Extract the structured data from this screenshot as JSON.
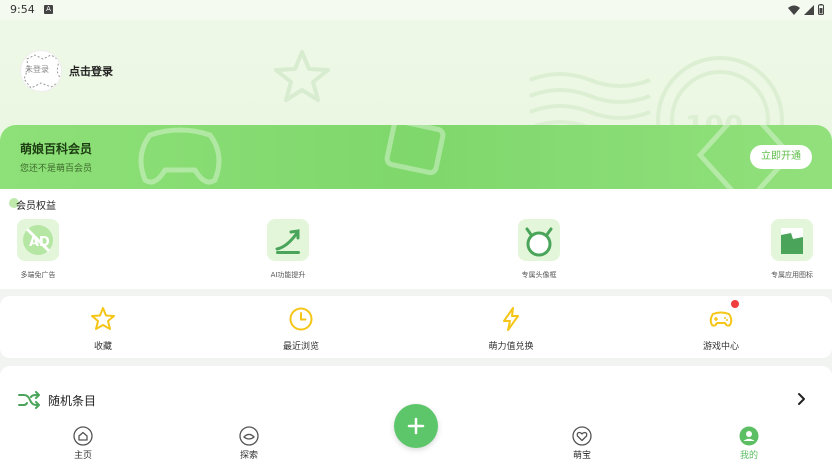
{
  "status": {
    "time": "9:54",
    "notification_icon": "A"
  },
  "profile": {
    "avatar_text": "未登录",
    "login_label": "点击登录"
  },
  "vip": {
    "title": "萌娘百科会员",
    "subtitle": "您还不是萌百会员",
    "button": "立即开通"
  },
  "benefits": {
    "title": "会员权益",
    "items": [
      {
        "label": "多端免广告",
        "icon": "no-ad-icon"
      },
      {
        "label": "AI功能提升",
        "icon": "trend-up-icon"
      },
      {
        "label": "专属头像框",
        "icon": "cat-avatar-frame-icon"
      },
      {
        "label": "专属应用图标",
        "icon": "app-icon"
      }
    ]
  },
  "quick": [
    {
      "label": "收藏",
      "icon": "star-icon"
    },
    {
      "label": "最近浏览",
      "icon": "clock-icon"
    },
    {
      "label": "萌力值兑换",
      "icon": "lightning-icon"
    },
    {
      "label": "游戏中心",
      "icon": "gamepad-icon"
    }
  ],
  "random": {
    "label": "随机条目",
    "icon": "shuffle-icon"
  },
  "nav": [
    {
      "label": "主页",
      "icon": "home-icon"
    },
    {
      "label": "探索",
      "icon": "explore-icon"
    },
    {
      "label": "萌宝",
      "icon": "heart-icon"
    },
    {
      "label": "我的",
      "icon": "profile-icon"
    }
  ],
  "colors": {
    "accent": "#5cbf63",
    "vip_green": "#8ee078",
    "icon_yellow": "#f5c518",
    "badge_red": "#f03c3c"
  }
}
